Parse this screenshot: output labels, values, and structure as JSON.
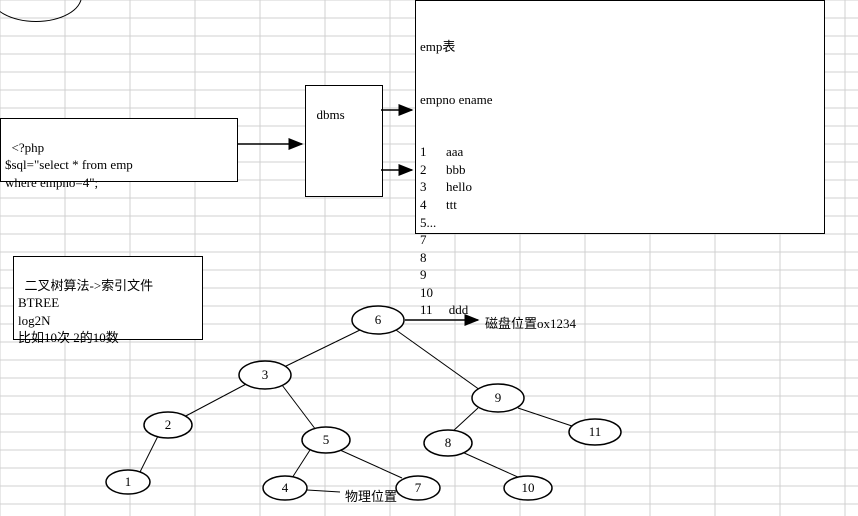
{
  "php_box": {
    "text": "<?php\n$sql=\"select * from emp\nwhere empno=4\";"
  },
  "dbms_box": {
    "label": "dbms"
  },
  "emp_box": {
    "title": "emp表",
    "header": "empno ename",
    "rows_text": "1      aaa\n2      bbb\n3      hello\n4      ttt\n5...\n7\n8\n9\n10\n11     ddd",
    "rows": [
      {
        "empno": "1",
        "ename": "aaa"
      },
      {
        "empno": "2",
        "ename": "bbb"
      },
      {
        "empno": "3",
        "ename": "hello"
      },
      {
        "empno": "4",
        "ename": "ttt"
      },
      {
        "empno": "5...",
        "ename": ""
      },
      {
        "empno": "7",
        "ename": ""
      },
      {
        "empno": "8",
        "ename": ""
      },
      {
        "empno": "9",
        "ename": ""
      },
      {
        "empno": "10",
        "ename": ""
      },
      {
        "empno": "11",
        "ename": "ddd"
      }
    ]
  },
  "btree_box": {
    "text": "二叉树算法->索引文件\nBTREE\nlog2N\n比如10次 2的10数"
  },
  "labels": {
    "disk_pos": "磁盘位置ox1234",
    "phys_pos": "物理位置"
  },
  "tree": {
    "nodes": {
      "n6": "6",
      "n3": "3",
      "n9": "9",
      "n2": "2",
      "n5": "5",
      "n8": "8",
      "n11": "11",
      "n1": "1",
      "n4": "4",
      "n7": "7",
      "n10": "10"
    }
  }
}
